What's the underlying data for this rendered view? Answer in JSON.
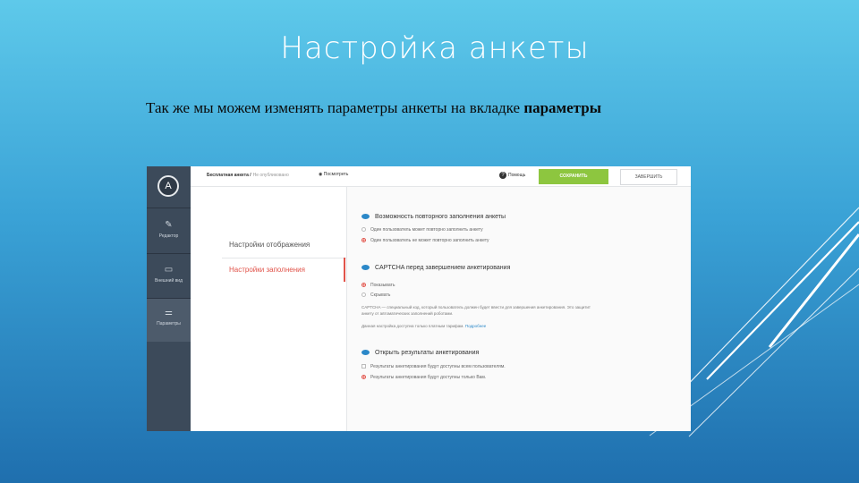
{
  "slide": {
    "title": "Настройка анкеты",
    "subtitle_prefix": "Так же мы  можем изменять параметры анкеты на вкладке ",
    "subtitle_bold": "параметры"
  },
  "app": {
    "logo_letter": "A",
    "sidebar": [
      {
        "label": "Редактор",
        "icon": "pencil-icon"
      },
      {
        "label": "Внешний вид",
        "icon": "monitor-icon"
      },
      {
        "label": "Параметры",
        "icon": "toggles-icon"
      }
    ],
    "topbar": {
      "survey_title": "Бесплатная анкета /",
      "survey_status": "Не опубликовано",
      "preview": "Посмотреть",
      "help": "Помощь",
      "save": "СОХРАНИТЬ",
      "finish": "ЗАВЕРШИТЬ"
    },
    "subnav": {
      "display": "Настройки отображения",
      "filling": "Настройки заполнения"
    },
    "sections": [
      {
        "title": "Возможность повторного заполнения анкеты",
        "options": [
          "Один пользователь может повторно заполнить анкету",
          "Один пользователь не может повторно заполнить анкету"
        ]
      },
      {
        "title": "CAPTCHA перед завершением анкетирования",
        "options": [
          "Показывать",
          "Скрывать"
        ],
        "note": "CAPTCHA — специальный код, который пользователь должен будет ввести для завершения анкетирования. Это защитит анкету от автоматических заполнений роботами.",
        "note2": "Данная настройка доступна только платным тарифам.",
        "note2_link": "Подробнее"
      },
      {
        "title": "Открыть результаты анкетирования",
        "options": [
          "Результаты анкетирования будут доступны всем пользователям.",
          "Результаты анкетирования будут доступны только Вам."
        ]
      }
    ]
  }
}
